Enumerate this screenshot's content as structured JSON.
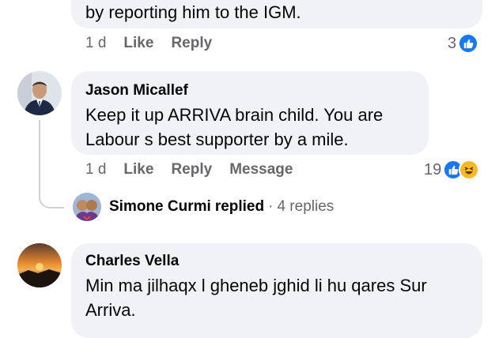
{
  "comment0": {
    "text_tail": "by reporting him to the IGM.",
    "time": "1 d",
    "like": "Like",
    "reply": "Reply",
    "reaction_count": "3"
  },
  "comment1": {
    "author": "Jason Micallef",
    "text": "Keep it up ARRIVA brain child. You are Labour s best supporter by a mile.",
    "time": "1 d",
    "like": "Like",
    "reply": "Reply",
    "message": "Message",
    "reaction_count": "19"
  },
  "replies_summary": {
    "name": "Simone Curmi",
    "replied": "replied",
    "separator": "·",
    "count": "4 replies"
  },
  "comment2": {
    "author": "Charles Vella",
    "text": "Min ma jilhaqx l gheneb jghid li hu qares Sur Arriva."
  },
  "colors": {
    "bubble": "#f0f2f5",
    "meta": "#65676b",
    "like_blue": "#1877f2",
    "haha_yellow": "#f7b928"
  },
  "icons": [
    "like-reaction-icon",
    "haha-reaction-icon"
  ]
}
